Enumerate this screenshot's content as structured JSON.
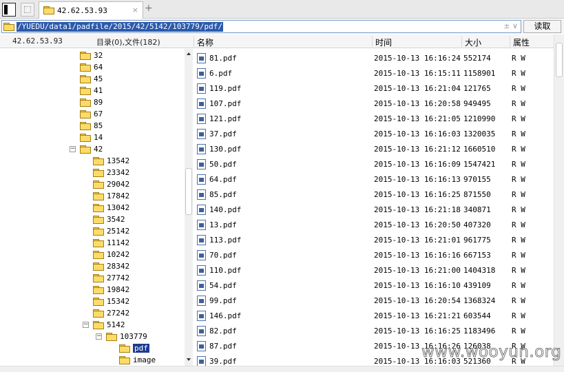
{
  "tabs": {
    "active_label": "42.62.53.93",
    "close_glyph": "×",
    "add_glyph": "+"
  },
  "address": {
    "path": "/YUEDU/data1/padfile/2015/42/5142/103779/pdf/",
    "controls": "± ∨",
    "read_button": "读取"
  },
  "tree_header": {
    "host": "42.62.53.93",
    "counts": "目录(0),文件(182)"
  },
  "columns": {
    "name": "名称",
    "time": "时间",
    "size": "大小",
    "attr": "属性"
  },
  "tree": [
    {
      "label": "32",
      "depth": 0
    },
    {
      "label": "64",
      "depth": 0
    },
    {
      "label": "45",
      "depth": 0
    },
    {
      "label": "41",
      "depth": 0
    },
    {
      "label": "89",
      "depth": 0
    },
    {
      "label": "67",
      "depth": 0
    },
    {
      "label": "85",
      "depth": 0
    },
    {
      "label": "14",
      "depth": 0
    },
    {
      "label": "42",
      "depth": 0,
      "expander": "−"
    },
    {
      "label": "13542",
      "depth": 1
    },
    {
      "label": "23342",
      "depth": 1
    },
    {
      "label": "29042",
      "depth": 1
    },
    {
      "label": "17842",
      "depth": 1
    },
    {
      "label": "13042",
      "depth": 1
    },
    {
      "label": "3542",
      "depth": 1
    },
    {
      "label": "25142",
      "depth": 1
    },
    {
      "label": "11142",
      "depth": 1
    },
    {
      "label": "10242",
      "depth": 1
    },
    {
      "label": "28342",
      "depth": 1
    },
    {
      "label": "27742",
      "depth": 1
    },
    {
      "label": "19842",
      "depth": 1
    },
    {
      "label": "15342",
      "depth": 1
    },
    {
      "label": "27242",
      "depth": 1
    },
    {
      "label": "5142",
      "depth": 1,
      "expander": "−"
    },
    {
      "label": "103779",
      "depth": 2,
      "expander": "−"
    },
    {
      "label": "pdf",
      "depth": 3,
      "selected": true
    },
    {
      "label": "image",
      "depth": 3
    }
  ],
  "files": [
    {
      "name": "81.pdf",
      "time": "2015-10-13 16:16:24",
      "size": "552174",
      "attr": "R W"
    },
    {
      "name": "6.pdf",
      "time": "2015-10-13 16:15:11",
      "size": "1158901",
      "attr": "R W"
    },
    {
      "name": "119.pdf",
      "time": "2015-10-13 16:21:04",
      "size": "121765",
      "attr": "R W"
    },
    {
      "name": "107.pdf",
      "time": "2015-10-13 16:20:58",
      "size": "949495",
      "attr": "R W"
    },
    {
      "name": "121.pdf",
      "time": "2015-10-13 16:21:05",
      "size": "1210990",
      "attr": "R W"
    },
    {
      "name": "37.pdf",
      "time": "2015-10-13 16:16:03",
      "size": "1320035",
      "attr": "R W"
    },
    {
      "name": "130.pdf",
      "time": "2015-10-13 16:21:12",
      "size": "1660510",
      "attr": "R W"
    },
    {
      "name": "50.pdf",
      "time": "2015-10-13 16:16:09",
      "size": "1547421",
      "attr": "R W"
    },
    {
      "name": "64.pdf",
      "time": "2015-10-13 16:16:13",
      "size": "970155",
      "attr": "R W"
    },
    {
      "name": "85.pdf",
      "time": "2015-10-13 16:16:25",
      "size": "871550",
      "attr": "R W"
    },
    {
      "name": "140.pdf",
      "time": "2015-10-13 16:21:18",
      "size": "340871",
      "attr": "R W"
    },
    {
      "name": "13.pdf",
      "time": "2015-10-13 16:20:50",
      "size": "407320",
      "attr": "R W"
    },
    {
      "name": "113.pdf",
      "time": "2015-10-13 16:21:01",
      "size": "961775",
      "attr": "R W"
    },
    {
      "name": "70.pdf",
      "time": "2015-10-13 16:16:16",
      "size": "667153",
      "attr": "R W"
    },
    {
      "name": "110.pdf",
      "time": "2015-10-13 16:21:00",
      "size": "1404318",
      "attr": "R W"
    },
    {
      "name": "54.pdf",
      "time": "2015-10-13 16:16:10",
      "size": "439109",
      "attr": "R W"
    },
    {
      "name": "99.pdf",
      "time": "2015-10-13 16:20:54",
      "size": "1368324",
      "attr": "R W"
    },
    {
      "name": "146.pdf",
      "time": "2015-10-13 16:21:21",
      "size": "603544",
      "attr": "R W"
    },
    {
      "name": "82.pdf",
      "time": "2015-10-13 16:16:25",
      "size": "1183496",
      "attr": "R W"
    },
    {
      "name": "87.pdf",
      "time": "2015-10-13 16:16:26",
      "size": "126038",
      "attr": "R W"
    },
    {
      "name": "39.pdf",
      "time": "2015-10-13 16:16:03",
      "size": "521360",
      "attr": "R W"
    }
  ],
  "watermark": "www.wooyun.org"
}
